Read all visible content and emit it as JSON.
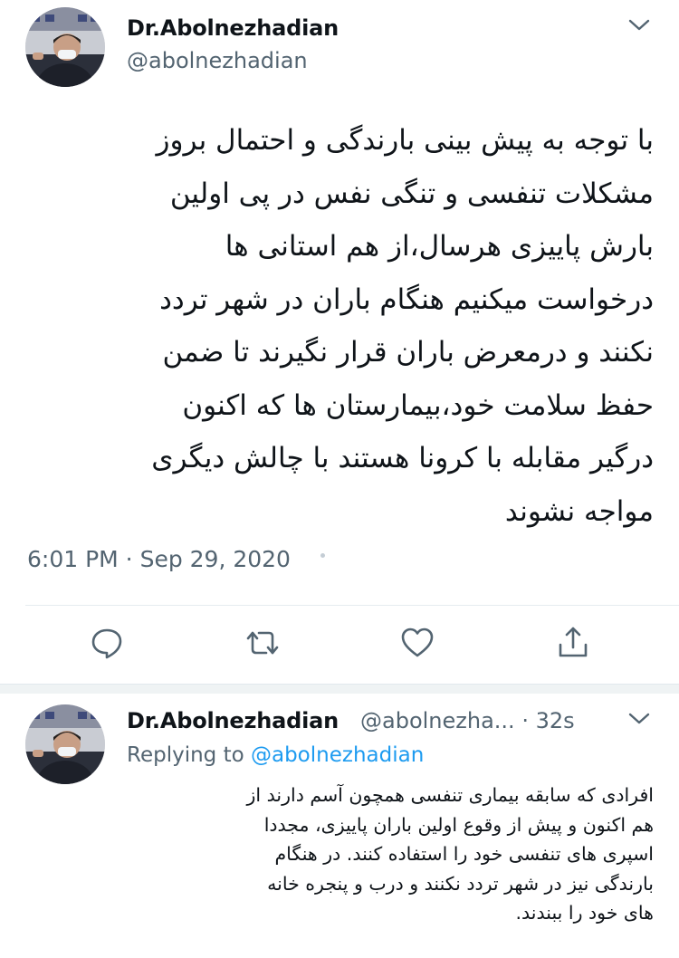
{
  "main_tweet": {
    "display_name": "Dr.Abolnezhadian",
    "handle": "@abolnezhadian",
    "body_lines": [
      "با توجه به پیش بینی بارندگی و احتمال بروز",
      "مشکلات تنفسی و تنگی نفس در پی اولین",
      "بارش پاییزی هرسال،از هم استانی ها",
      "درخواست میکنیم هنگام باران در شهر تردد",
      "نکنند و درمعرض باران قرار نگیرند تا ضمن",
      "حفظ سلامت خود،بیمارستان ها که اکنون",
      "درگیر مقابله با کرونا هستند با چالش دیگری",
      "مواجه نشوند"
    ],
    "timestamp": "6:01 PM · Sep 29, 2020"
  },
  "actions": {
    "reply_icon": "reply-icon",
    "retweet_icon": "retweet-icon",
    "like_icon": "heart-icon",
    "share_icon": "share-icon"
  },
  "reply_tweet": {
    "display_name": "Dr.Abolnezhadian",
    "handle": "@abolnezha...",
    "separator": "·",
    "time_ago": "32s",
    "replying_prefix": "Replying to",
    "replying_mention": "@abolnezhadian",
    "body_lines": [
      "افرادی که سابقه بیماری تنفسی همچون آسم دارند از",
      "هم اکنون و پیش از وقوع اولین باران پاییزی، مجددا",
      "اسپری های تنفسی خود را استفاده کنند. در هنگام",
      "بارندگی نیز در شهر تردد نکنند و درب و پنجره خانه",
      "های خود را ببندند."
    ]
  },
  "colors": {
    "text": "#0f1419",
    "secondary": "#536471",
    "link": "#1d9bf0",
    "icon": "#536471"
  }
}
